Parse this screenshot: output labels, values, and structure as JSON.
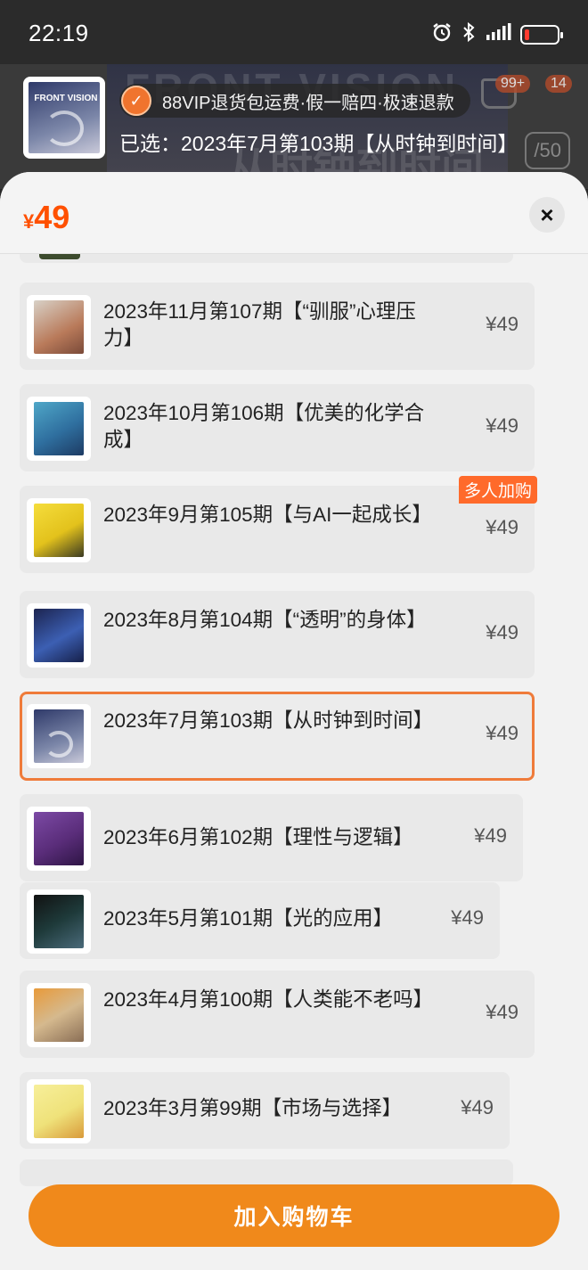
{
  "status_bar": {
    "time": "22:19",
    "icons": [
      "alarm-icon",
      "bluetooth-icon",
      "signal-icon",
      "battery-icon"
    ]
  },
  "background": {
    "badge_cart": "99+",
    "badge_other": "14",
    "page_counter": "/50"
  },
  "header": {
    "vip_text": "88VIP退货包运费·假一赔四·极速退款",
    "selected_text": "已选：2023年7月第103期【从时钟到时间】"
  },
  "sheet": {
    "currency": "¥",
    "price": "49",
    "close_label": "×"
  },
  "items": [
    {
      "name": "2023年11月第107期【“驯服”心理压力】",
      "price": "¥49",
      "cover_color": "#b97a5a",
      "selected": false
    },
    {
      "name": "2023年10月第106期【优美的化学合成】",
      "price": "¥49",
      "cover_color": "#2f6f9f",
      "selected": false
    },
    {
      "name": "2023年9月第105期【与AI一起成长】",
      "price": "¥49",
      "cover_color": "#e3c21c",
      "selected": false,
      "tag": "多人加购"
    },
    {
      "name": "2023年8月第104期【“透明”的身体】",
      "price": "¥49",
      "cover_color": "#24346b",
      "selected": false
    },
    {
      "name": "2023年7月第103期【从时钟到时间】",
      "price": "¥49",
      "cover_color": "#3a3f5c",
      "selected": true
    },
    {
      "name": "2023年6月第102期【理性与逻辑】",
      "price": "¥49",
      "cover_color": "#5a2d7a",
      "selected": false
    },
    {
      "name": "2023年5月第101期【光的应用】",
      "price": "¥49",
      "cover_color": "#1e3a3a",
      "selected": false
    },
    {
      "name": "2023年4月第100期【人类能不老吗】",
      "price": "¥49",
      "cover_color": "#d5b98e",
      "selected": false
    },
    {
      "name": "2023年3月第99期【市场与选择】",
      "price": "¥49",
      "cover_color": "#efe27a",
      "selected": false
    }
  ],
  "add_to_cart_label": "加入购物车"
}
